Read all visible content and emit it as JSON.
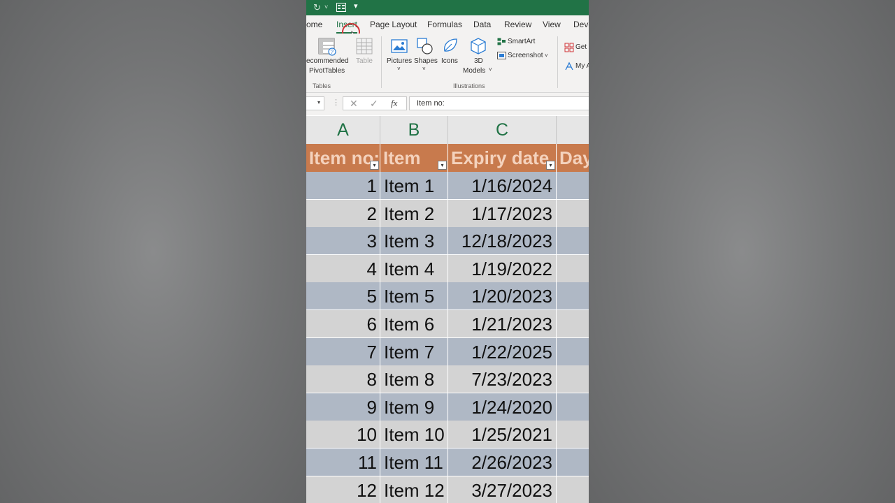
{
  "ribbon_tabs": [
    {
      "label": "ome",
      "active": false
    },
    {
      "label": "Insert",
      "active": true
    },
    {
      "label": "Page Layout",
      "active": false
    },
    {
      "label": "Formulas",
      "active": false
    },
    {
      "label": "Data",
      "active": false
    },
    {
      "label": "Review",
      "active": false
    },
    {
      "label": "View",
      "active": false
    },
    {
      "label": "Deve",
      "active": false
    }
  ],
  "ribbon": {
    "recommended_pivottables_line1": "ecommended",
    "recommended_pivottables_line2": "PivotTables",
    "table": "Table",
    "pictures": "Pictures",
    "shapes": "Shapes",
    "icons": "Icons",
    "models_line1": "3D",
    "models_line2": "Models",
    "smartart": "SmartArt",
    "screenshot": "Screenshot",
    "get_addins": "Get",
    "my_addins": "My A",
    "group_tables": "Tables",
    "group_illustrations": "Illustrations"
  },
  "formula_bar": {
    "fx": "fx",
    "content": "Item no:"
  },
  "column_headers": [
    "A",
    "B",
    "C"
  ],
  "table": {
    "headers": [
      "Item no:",
      "Item",
      "Expiry date",
      "Day"
    ],
    "rows": [
      {
        "no": "1",
        "item": "Item 1",
        "expiry": "1/16/2024"
      },
      {
        "no": "2",
        "item": "Item 2",
        "expiry": "1/17/2023"
      },
      {
        "no": "3",
        "item": "Item 3",
        "expiry": "12/18/2023"
      },
      {
        "no": "4",
        "item": "Item 4",
        "expiry": "1/19/2022"
      },
      {
        "no": "5",
        "item": "Item 5",
        "expiry": "1/20/2023"
      },
      {
        "no": "6",
        "item": "Item 6",
        "expiry": "1/21/2023"
      },
      {
        "no": "7",
        "item": "Item 7",
        "expiry": "1/22/2025"
      },
      {
        "no": "8",
        "item": "Item 8",
        "expiry": "7/23/2023"
      },
      {
        "no": "9",
        "item": "Item 9",
        "expiry": "1/24/2020"
      },
      {
        "no": "10",
        "item": "Item 10",
        "expiry": "1/25/2021"
      },
      {
        "no": "11",
        "item": "Item 11",
        "expiry": "2/26/2023"
      },
      {
        "no": "12",
        "item": "Item 12",
        "expiry": "3/27/2023"
      }
    ]
  },
  "colors": {
    "excel_green": "#217346",
    "table_header": "#c87a4d",
    "band_odd": "#afb8c5",
    "band_even": "#d3d3d3"
  }
}
